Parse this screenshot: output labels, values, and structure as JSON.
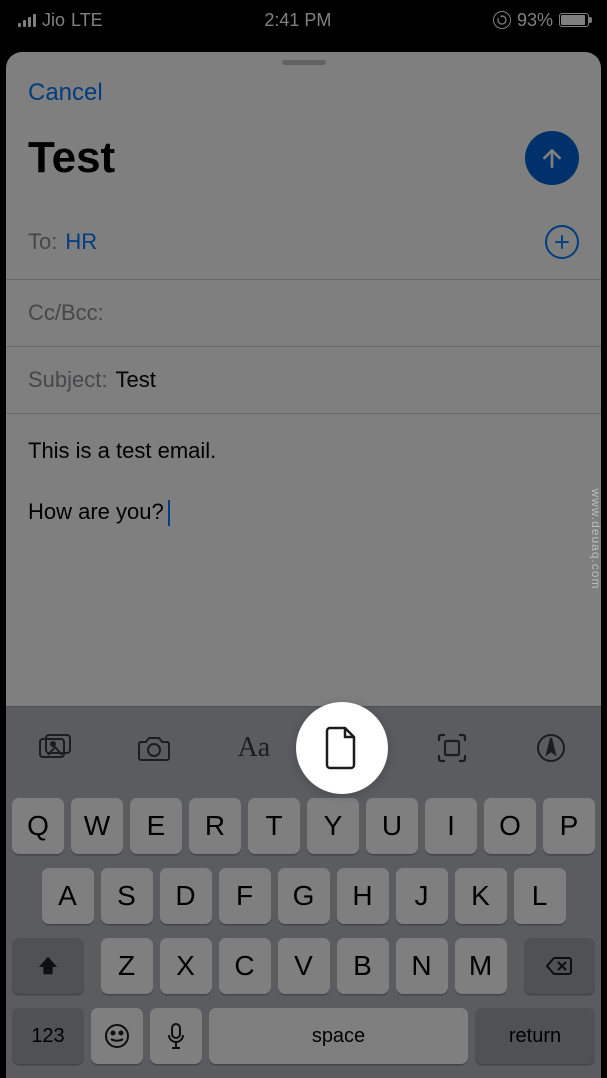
{
  "status": {
    "carrier": "Jio",
    "network": "LTE",
    "time": "2:41 PM",
    "battery_pct": "93%",
    "battery_fill_pct": 93
  },
  "compose": {
    "cancel_label": "Cancel",
    "title": "Test",
    "fields": {
      "to_label": "To:",
      "to_value": "HR",
      "ccbcc_label": "Cc/Bcc:",
      "ccbcc_value": "",
      "subject_label": "Subject:",
      "subject_value": "Test"
    },
    "body_lines": [
      "This is a test email.",
      "How are you?"
    ]
  },
  "toolbar": {
    "items": [
      "photos-icon",
      "camera-icon",
      "text-format-icon",
      "document-icon",
      "scan-icon",
      "markup-icon"
    ],
    "text_format_label": "Aa"
  },
  "keyboard": {
    "row1": [
      "Q",
      "W",
      "E",
      "R",
      "T",
      "Y",
      "U",
      "I",
      "O",
      "P"
    ],
    "row2": [
      "A",
      "S",
      "D",
      "F",
      "G",
      "H",
      "J",
      "K",
      "L"
    ],
    "row3": [
      "Z",
      "X",
      "C",
      "V",
      "B",
      "N",
      "M"
    ],
    "num_label": "123",
    "space_label": "space",
    "return_label": "return"
  },
  "watermark": "www.deuaq.com"
}
